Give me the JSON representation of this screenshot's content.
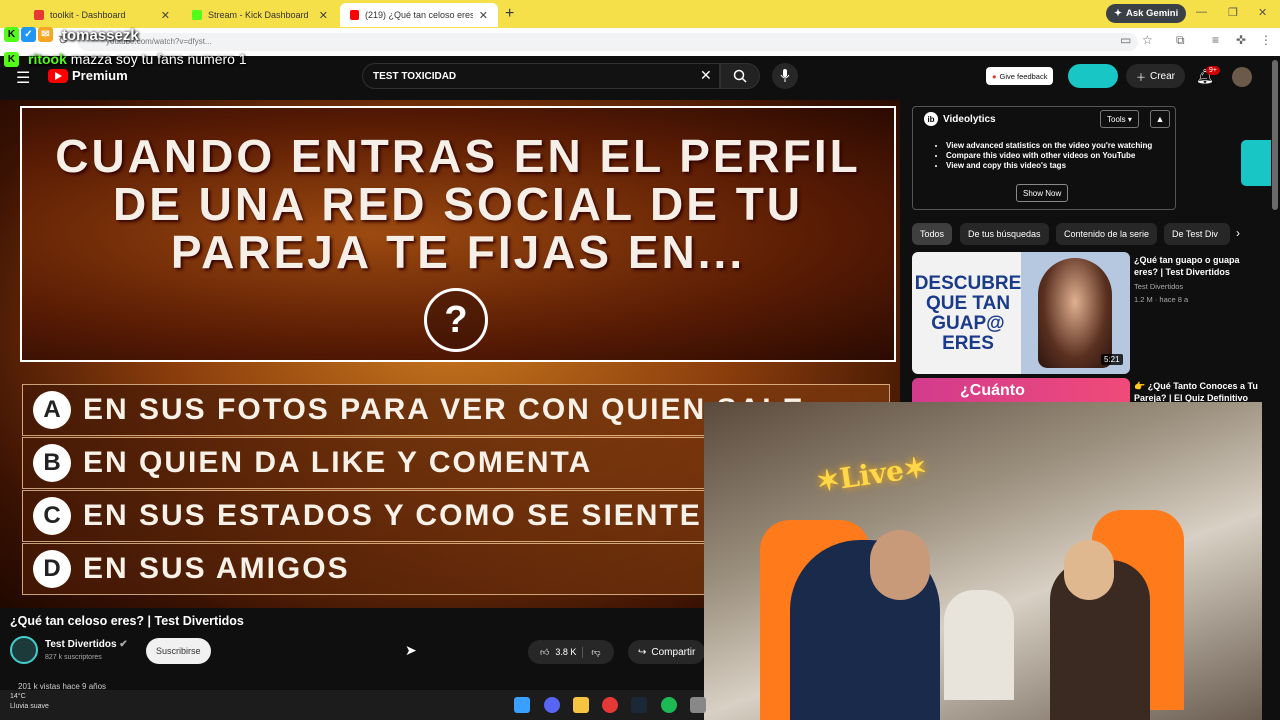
{
  "browser": {
    "tabs": [
      {
        "label": "toolkit - Dashboard",
        "color": "#e53935"
      },
      {
        "label": "Stream - Kick Dashboard",
        "color": "#53fc18"
      },
      {
        "label": "(219) ¿Qué tan celoso eres? | Te",
        "color": "#ff0000"
      }
    ],
    "gemini": "Ask Gemini",
    "url": "youtube.com/watch?v=dfyst...",
    "new_tab": "+"
  },
  "overlay": {
    "streamer": "tomassezk",
    "chat_user": "ritook",
    "chat_message": "mazza soy tu fans numero 1"
  },
  "youtube": {
    "logo": "Premium",
    "search_value": "TEST TOXICIDAD",
    "feedback": "Give feedback",
    "create": "Crear",
    "notifications": "9+"
  },
  "video": {
    "question": "CUANDO ENTRAS EN EL PERFIL DE UNA RED SOCIAL DE TU PAREJA TE FIJAS EN...",
    "qmark": "?",
    "options": [
      {
        "letter": "A",
        "text": "EN SUS FOTOS PARA VER CON QUIEN SALE"
      },
      {
        "letter": "B",
        "text": "EN QUIEN DA LIKE Y COMENTA"
      },
      {
        "letter": "C",
        "text": "EN SUS ESTADOS Y COMO SE SIENTE"
      },
      {
        "letter": "D",
        "text": "EN SUS AMIGOS"
      }
    ]
  },
  "details": {
    "title": "¿Qué tan celoso eres? | Test Divertidos",
    "channel": "Test Divertidos",
    "subs": "827 k suscriptores",
    "subscribe": "Suscribirse",
    "likes": "3.8 K",
    "share": "Compartir",
    "views": "201 k vistas hace 9 años"
  },
  "sidebar": {
    "videolytics": {
      "title": "Videolytics",
      "tools": "Tools",
      "bullets": [
        "View advanced statistics on the video you're watching",
        "Compare this video with other videos on YouTube",
        "View and copy this video's tags"
      ],
      "show_now": "Show Now"
    },
    "chips": [
      "Todos",
      "De tus búsquedas",
      "Contenido de la serie",
      "De Test Div"
    ],
    "recs": [
      {
        "thumb_text": "DESCUBRE QUE TAN GUAP@ ERES",
        "duration": "5:21",
        "title": "¿Qué tan guapo o guapa eres? | Test Divertidos",
        "channel": "Test Divertidos",
        "meta": "1.2 M · hace 8 a"
      },
      {
        "thumb_text": "¿Cuánto",
        "title": "👉 ¿Qué Tanto Conoces a Tu Pareja? | El Quiz Definitivo"
      }
    ]
  },
  "taskbar": {
    "temp": "14°C",
    "weather": "Lluvia suave"
  }
}
